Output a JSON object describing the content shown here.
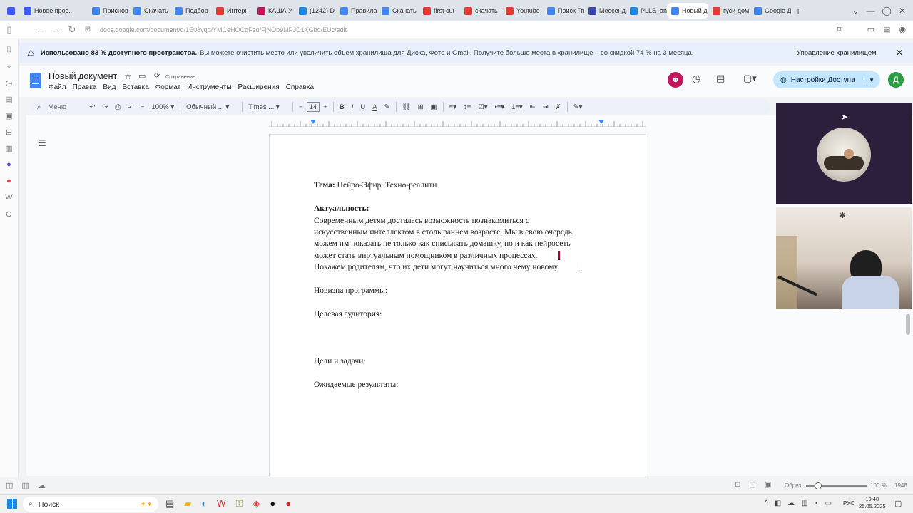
{
  "browser": {
    "tabs": [
      {
        "label": "Новое прос...",
        "color": "#3d5afe"
      },
      {
        "label": "Приснов",
        "color": "#4285f4"
      },
      {
        "label": "Скачать",
        "color": "#4285f4"
      },
      {
        "label": "Подбор",
        "color": "#4285f4"
      },
      {
        "label": "Интерн",
        "color": "#e53935"
      },
      {
        "label": "КАША У",
        "color": "#c2185b"
      },
      {
        "label": "(1242) D",
        "color": "#1e88e5"
      },
      {
        "label": "Правила",
        "color": "#4285f4"
      },
      {
        "label": "Скачать",
        "color": "#4285f4"
      },
      {
        "label": "first cut",
        "color": "#e53935"
      },
      {
        "label": "скачать",
        "color": "#e53935"
      },
      {
        "label": "Youtube",
        "color": "#e53935"
      },
      {
        "label": "Поиск Гп",
        "color": "#4285f4"
      },
      {
        "label": "Мессенд",
        "color": "#3949ab"
      },
      {
        "label": "PLLS_and",
        "color": "#1e88e5"
      },
      {
        "label": "Новый д",
        "color": "#4285f4",
        "active": true
      },
      {
        "label": "гуси дом",
        "color": "#e53935"
      },
      {
        "label": "Google Д",
        "color": "#4285f4"
      }
    ],
    "new_tab": "+",
    "url": "docs.google.com/document/d/1E08yqg/YMCeHOCqFeo/FjNOb9MPJC1XGbd/EUc/edit"
  },
  "banner": {
    "bold": "Использовано 83 % доступного пространства.",
    "text": "Вы можете очистить место или увеличить объем хранилища для Диска, Фото и Gmail. Получите больше места в хранилище – со скидкой 74 % на 3 месяца.",
    "action": "Управление хранилищем"
  },
  "doc": {
    "title": "Новый документ",
    "saving": "Сохранение...",
    "menu": [
      "Файл",
      "Правка",
      "Вид",
      "Вставка",
      "Формат",
      "Инструменты",
      "Расширения",
      "Справка"
    ],
    "share_label": "Настройки Доступа",
    "avatar_letter": "Д"
  },
  "toolbar": {
    "menu_search": "Меню",
    "zoom": "100%",
    "style": "Обычный ...",
    "font": "Times ...",
    "font_size": "14"
  },
  "content": {
    "topic_label": "Тема:",
    "topic_value": " Нейро-Эфир. Техно-реалити",
    "relevance_label": "Актуальность:",
    "relevance_lines": [
      "Современным детям досталась возможность познакомиться с",
      "искусственным интеллектом в столь раннем возрасте. Мы в свою очередь",
      "можем им показать не только как списывать домашку, но и как нейросеть",
      "может стать виртуальным помощником в различных процессах.",
      "Покажем родителям, что их дети могут научиться много чему новому"
    ],
    "novelty": "Новизна программы:",
    "audience": "Целевая аудитория:",
    "goals": "Цели и задачи:",
    "results": "Ожидаемые результаты:"
  },
  "statusbar": {
    "zoom_label": "Обрез.",
    "zoom_value": "100 %",
    "page_info": "1948"
  },
  "taskbar": {
    "search": "Поиск",
    "lang": "РУС",
    "time": "19:48",
    "date": "25.05.2025"
  }
}
